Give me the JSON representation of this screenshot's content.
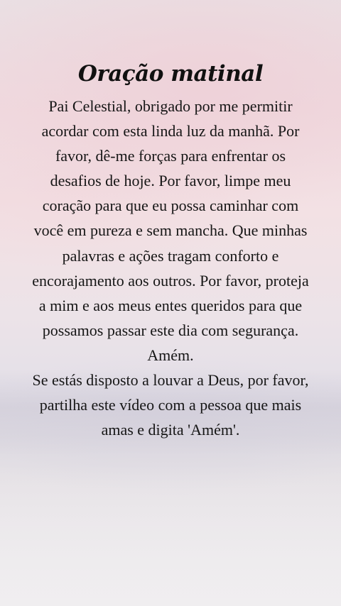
{
  "title": "Oração matinal",
  "prayer": "Pai Celestial, obrigado por me permitir acordar com esta linda luz da manhã. Por favor, dê-me forças para enfrentar os desafios de hoje. Por favor, limpe meu coração para que eu possa caminhar com você em pureza e sem mancha. Que minhas palavras e ações tragam conforto e encorajamento aos outros. Por favor, proteja a mim e aos meus entes queridos para que possamos passar este dia com segurança. Amém.",
  "call_to_action": "Se estás disposto a louvar a Deus, por favor, partilha este vídeo com a pessoa que mais amas e digita 'Amém'."
}
